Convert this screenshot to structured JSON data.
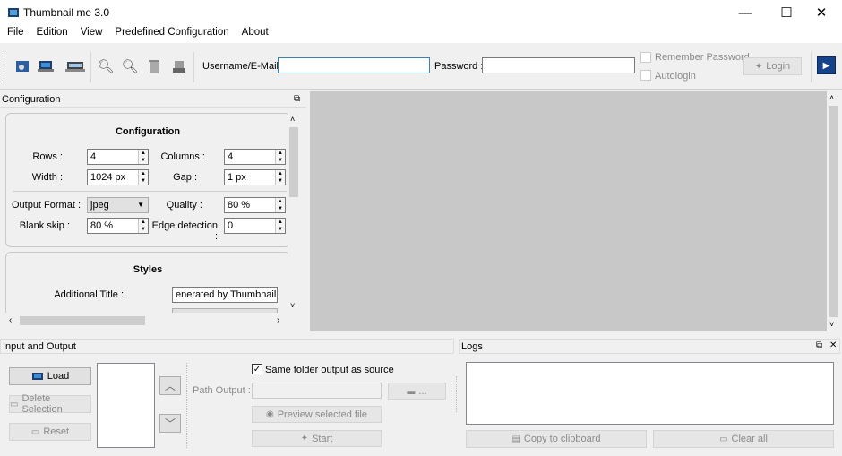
{
  "window": {
    "title": "Thumbnail me 3.0",
    "minimize": "—",
    "maximize": "☐",
    "close": "✕"
  },
  "menu": [
    "File",
    "Edition",
    "View",
    "Predefined Configuration",
    "About"
  ],
  "toolbar": {
    "icons": [
      "settings-icon",
      "open-file-icon",
      "scanner-icon",
      "zoom-in-icon",
      "zoom-out-icon",
      "delete-icon",
      "stamp-icon"
    ],
    "username_label": "Username/E-Mail :",
    "username_value": "",
    "password_label": "Password :",
    "password_value": "",
    "remember_password": "Remember Password",
    "autologin": "Autologin",
    "login": "Login"
  },
  "config_panel": {
    "dock_title": "Configuration",
    "group_title": "Configuration",
    "rows_label": "Rows :",
    "rows_value": "4",
    "columns_label": "Columns :",
    "columns_value": "4",
    "width_label": "Width :",
    "width_value": "1024 px",
    "gap_label": "Gap :",
    "gap_value": "1 px",
    "output_format_label": "Output Format :",
    "output_format_value": "jpeg",
    "quality_label": "Quality :",
    "quality_value": "80 %",
    "blank_skip_label": "Blank skip :",
    "blank_skip_value": "80 %",
    "edge_detection_label": "Edge detection :",
    "edge_detection_value": "0",
    "styles_title": "Styles",
    "additional_title_label": "Additional Title :",
    "additional_title_value": "enerated by Thumbnail me"
  },
  "io_panel": {
    "dock_title": "Input and Output",
    "load": "Load",
    "delete_selection": "Delete Selection",
    "reset": "Reset",
    "same_folder": "Same folder output as source",
    "path_output_label": "Path Output :",
    "browse": "...",
    "preview": "Preview selected file",
    "start": "Start"
  },
  "logs_panel": {
    "dock_title": "Logs",
    "copy": "Copy to clipboard",
    "clear": "Clear all"
  }
}
